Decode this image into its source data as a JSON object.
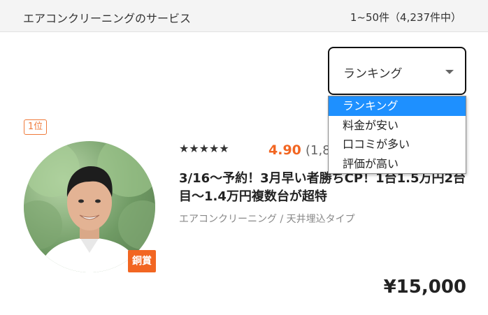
{
  "header": {
    "title": "エアコンクリーニングのサービス",
    "count": "1~50件（4,237件中）"
  },
  "sort": {
    "selected": "ランキング",
    "options": [
      "ランキング",
      "料金が安い",
      "口コミが多い",
      "評価が高い"
    ]
  },
  "listing": {
    "rank": "1位",
    "award": "銅賞",
    "stars": "★★★★★",
    "rating": "4.90",
    "reviews": "(1,8",
    "title": "3/16～予約！3月早い者勝ちCP！1台1.5万円2台目～1.4万円複数台が超特",
    "category": "エアコンクリーニング / 天井埋込タイプ",
    "price": "¥15,000"
  },
  "colors": {
    "accent": "#f26622",
    "selected_option": "#1e90ff"
  }
}
